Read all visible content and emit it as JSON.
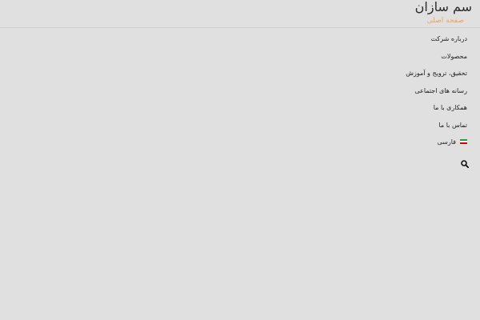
{
  "header": {
    "site_title": "سم سازان",
    "subtitle": "صفحه اصلی"
  },
  "menu": {
    "items": [
      {
        "label": "درباره شرکت"
      },
      {
        "label": "محصولات"
      },
      {
        "label": "تحقیق، ترویج و آموزش"
      },
      {
        "label": "رسانه های اجتماعی"
      },
      {
        "label": "همکاری با ما"
      },
      {
        "label": "تماس با ما"
      },
      {
        "label": "فارسی",
        "icon": "iran-flag-icon"
      }
    ]
  },
  "search": {
    "icon": "search-icon"
  },
  "colors": {
    "background": "#e0e0e0",
    "accent": "#f0a45a",
    "flag_green": "#239f40",
    "flag_white": "#ffffff",
    "flag_red": "#da0000"
  }
}
